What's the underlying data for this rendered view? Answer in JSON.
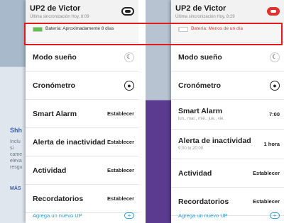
{
  "left": {
    "background": {
      "lines": [
        "Shh",
        "Inclu",
        "si",
        "came",
        "eleva",
        "resgu",
        "MÁS"
      ]
    },
    "header": {
      "title": "UP2 de Victor",
      "sync": "Última sincronización Hoy, 8:09"
    },
    "battery": {
      "text": "Batería: Aproximadamente 8 días",
      "level": 1.0
    },
    "menu": [
      {
        "label": "Modo sueño",
        "icon": "moon-icon"
      },
      {
        "label": "Cronómetro",
        "icon": "stopwatch-icon"
      },
      {
        "label": "Smart Alarm",
        "value": "Establecer"
      },
      {
        "label": "Alerta de inactividad",
        "value": "Establecer"
      },
      {
        "label": "Actividad",
        "value": "Establecer"
      },
      {
        "label": "Recordatorios",
        "value": "Establecer"
      }
    ],
    "add_up": "Agrega un nuevo UP"
  },
  "right": {
    "header": {
      "title": "UP2 de Victor",
      "sync": "Última sincronización Hoy, 8:29"
    },
    "battery": {
      "text": "Batería: Menos de un día",
      "level": 0.05
    },
    "menu": [
      {
        "label": "Modo sueño",
        "icon": "moon-icon"
      },
      {
        "label": "Cronómetro",
        "icon": "stopwatch-icon"
      },
      {
        "label": "Smart Alarm",
        "sub": "lun., mar., mié., jue., vie.",
        "value": "7:00"
      },
      {
        "label": "Alerta de inactividad",
        "sub": "9:00 to 20:00",
        "value": "1 hora"
      },
      {
        "label": "Actividad",
        "value": "Establecer"
      },
      {
        "label": "Recordatorios",
        "value": "Establecer"
      }
    ],
    "add_up": "Agrega un nuevo UP"
  },
  "colors": {
    "highlight": "#e11b1b",
    "battery_full": "#5ec34a",
    "battery_low_text": "#d84040",
    "link": "#2a9fd6"
  }
}
